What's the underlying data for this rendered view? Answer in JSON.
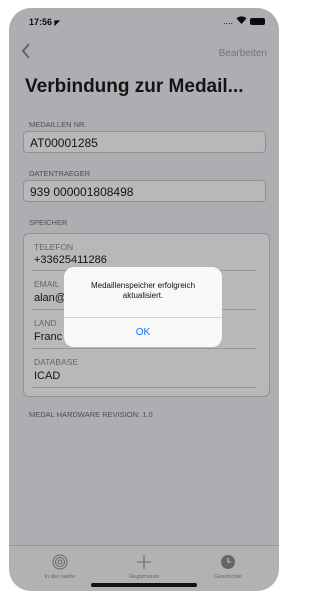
{
  "status_bar": {
    "time": "17:56",
    "location_arrow": "◤",
    "signal": "....",
    "wifi": "wifi"
  },
  "nav": {
    "back_icon": "chevron-left",
    "edit_label": "Bearbeiten"
  },
  "title": "Verbindung zur Medail...",
  "medal_number": {
    "label": "MEDAILLEN NR.",
    "value": "AT00001285"
  },
  "data_carrier": {
    "label": "DATENTRAEGER",
    "value": "939 000001808498"
  },
  "storage": {
    "label": "SPEICHER",
    "fields": [
      {
        "label": "TELEFON",
        "value": "+33625411286"
      },
      {
        "label": "EMAIL",
        "value": "alan@"
      },
      {
        "label": "LAND",
        "value": "Franc"
      },
      {
        "label": "DATABASE",
        "value": "ICAD"
      }
    ]
  },
  "revision_label": "MEDAL HARDWARE REVISION: 1.0",
  "alert": {
    "message": "Medaillenspeicher erfolgreich aktualisiert.",
    "ok_label": "OK"
  },
  "tabbar": {
    "items": [
      {
        "label": "In der naehe",
        "icon": "radar-icon"
      },
      {
        "label": "Registrieren",
        "icon": "plus-icon"
      },
      {
        "label": "Geschichte",
        "icon": "clock-icon"
      }
    ]
  },
  "colors": {
    "accent": "#1a73e8",
    "background": "#f2f2f7",
    "overlay": "rgba(0,0,0,0.28)"
  }
}
